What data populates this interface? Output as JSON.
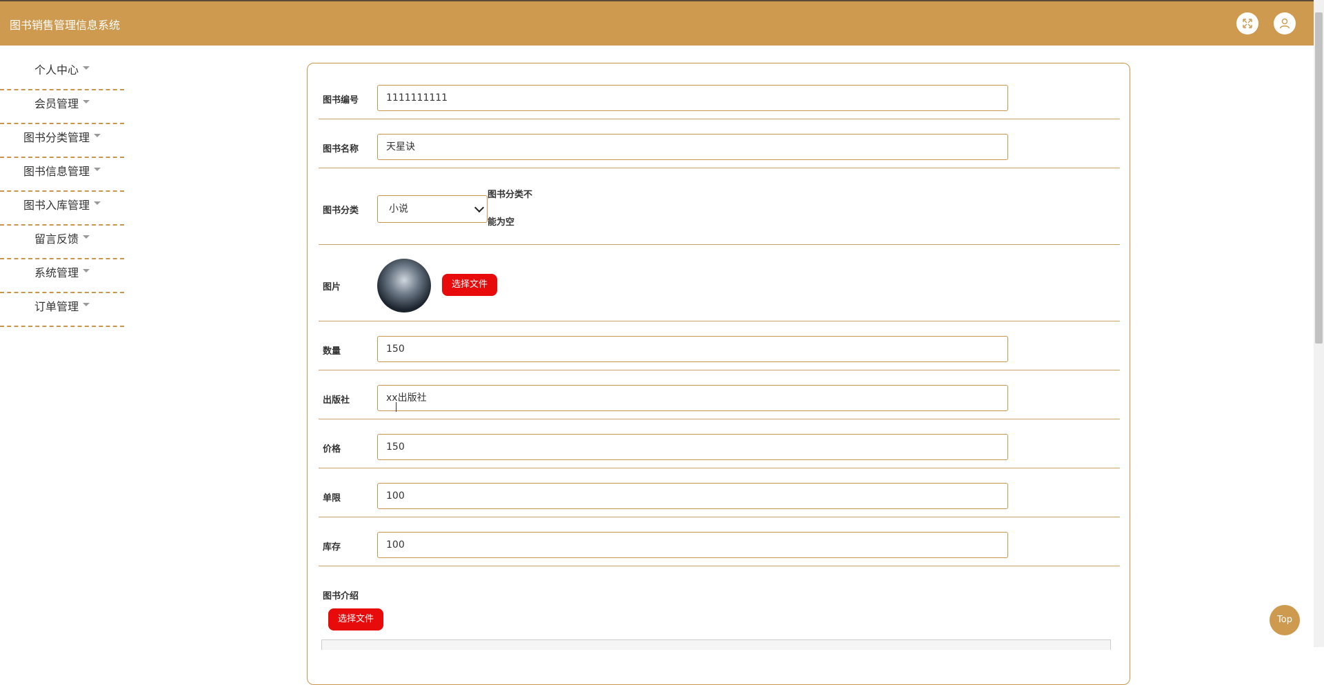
{
  "header": {
    "title": "图书销售管理信息系统",
    "fullscreen_icon": "expand-icon",
    "user_icon": "user-icon"
  },
  "sidebar": {
    "items": [
      {
        "label": "个人中心"
      },
      {
        "label": "会员管理"
      },
      {
        "label": "图书分类管理"
      },
      {
        "label": "图书信息管理"
      },
      {
        "label": "图书入库管理"
      },
      {
        "label": "留言反馈"
      },
      {
        "label": "系统管理"
      },
      {
        "label": "订单管理"
      }
    ]
  },
  "form": {
    "book_no": {
      "label": "图书编号",
      "value": "1111111111"
    },
    "book_name": {
      "label": "图书名称",
      "value": "天星诀"
    },
    "category": {
      "label": "图书分类",
      "value": "小说",
      "error_line1": "图书分类不",
      "error_line2": "能为空"
    },
    "image": {
      "label": "图片",
      "button": "选择文件"
    },
    "quantity": {
      "label": "数量",
      "value": "150"
    },
    "publisher": {
      "label": "出版社",
      "value": "xx出版社"
    },
    "price": {
      "label": "价格",
      "value": "150"
    },
    "limit": {
      "label": "单限",
      "value": "100"
    },
    "stock": {
      "label": "库存",
      "value": "100"
    },
    "intro": {
      "label": "图书介绍",
      "button": "选择文件"
    }
  },
  "top_button": "Top",
  "colors": {
    "brand": "#cd9a4f",
    "danger": "#e80b0b"
  }
}
